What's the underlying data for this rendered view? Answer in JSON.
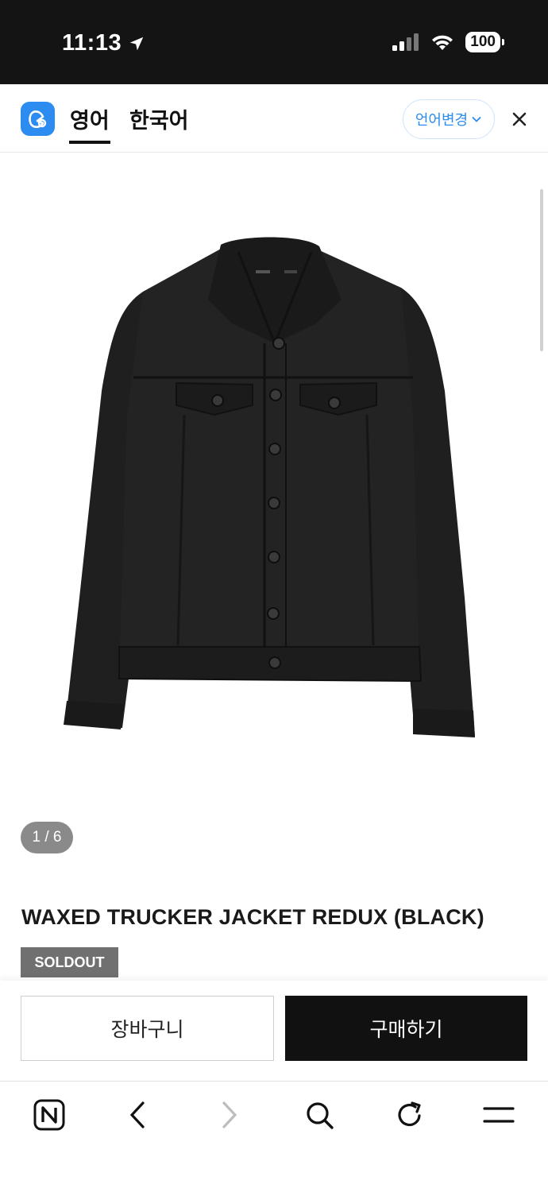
{
  "status_bar": {
    "time": "11:13",
    "battery": "100",
    "icons": [
      "location-arrow-icon",
      "signal-icon",
      "wifi-icon",
      "battery-icon"
    ]
  },
  "translate_bar": {
    "tabs": [
      {
        "label": "영어",
        "active": true
      },
      {
        "label": "한국어",
        "active": false
      }
    ],
    "change_language_label": "언어변경",
    "accent_color": "#2d8cf0"
  },
  "product": {
    "image_counter": "1 / 6",
    "title": "WAXED TRUCKER JACKET REDUX (BLACK)",
    "badge": "SOLDOUT",
    "image_description_icon": "black-denim-jacket"
  },
  "purchase_bar": {
    "cart_label": "장바구니",
    "buy_label": "구매하기"
  },
  "browser_toolbar": {
    "items": [
      "naver-home-icon",
      "back-icon",
      "forward-icon",
      "search-icon",
      "reload-icon",
      "menu-icon"
    ]
  }
}
